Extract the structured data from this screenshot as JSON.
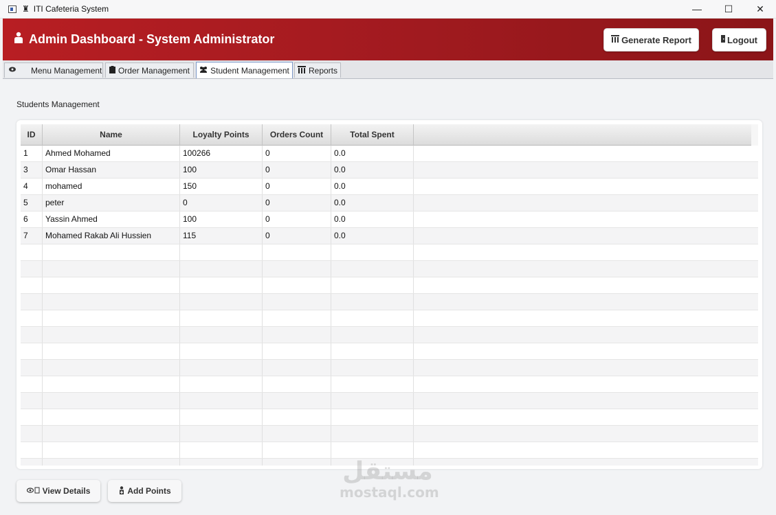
{
  "window": {
    "title": "ITI Cafeteria System",
    "controls": {
      "minimize": "—",
      "maximize": "☐",
      "close": "✕"
    }
  },
  "header": {
    "title": "Admin Dashboard - System Administrator",
    "icon": "person-icon",
    "generate_report_label": "Generate Report",
    "logout_label": "Logout"
  },
  "tabs": {
    "menu": "Menu Management",
    "order": "Order Management",
    "student": "Student Management",
    "reports": "Reports",
    "active": "student"
  },
  "main": {
    "section_label": "Students Management",
    "table": {
      "columns": [
        "ID",
        "Name",
        "Loyalty Points",
        "Orders Count",
        "Total Spent"
      ],
      "rows": [
        [
          "1",
          "Ahmed Mohamed",
          "100266",
          "0",
          "0.0"
        ],
        [
          "3",
          "Omar Hassan",
          "100",
          "0",
          "0.0"
        ],
        [
          "4",
          "mohamed",
          "150",
          "0",
          "0.0"
        ],
        [
          "5",
          "peter",
          "0",
          "0",
          "0.0"
        ],
        [
          "6",
          "Yassin Ahmed",
          "100",
          "0",
          "0.0"
        ],
        [
          "7",
          "Mohamed Rakab Ali Hussien",
          "115",
          "0",
          "0.0"
        ]
      ]
    },
    "view_details_label": "View Details",
    "add_points_label": "Add Points"
  },
  "watermark": {
    "arabic": "مستقل",
    "latin": "mostaql.com"
  },
  "colors": {
    "header_red": "#b81e23",
    "active_tab_border": "#7c98c8"
  }
}
